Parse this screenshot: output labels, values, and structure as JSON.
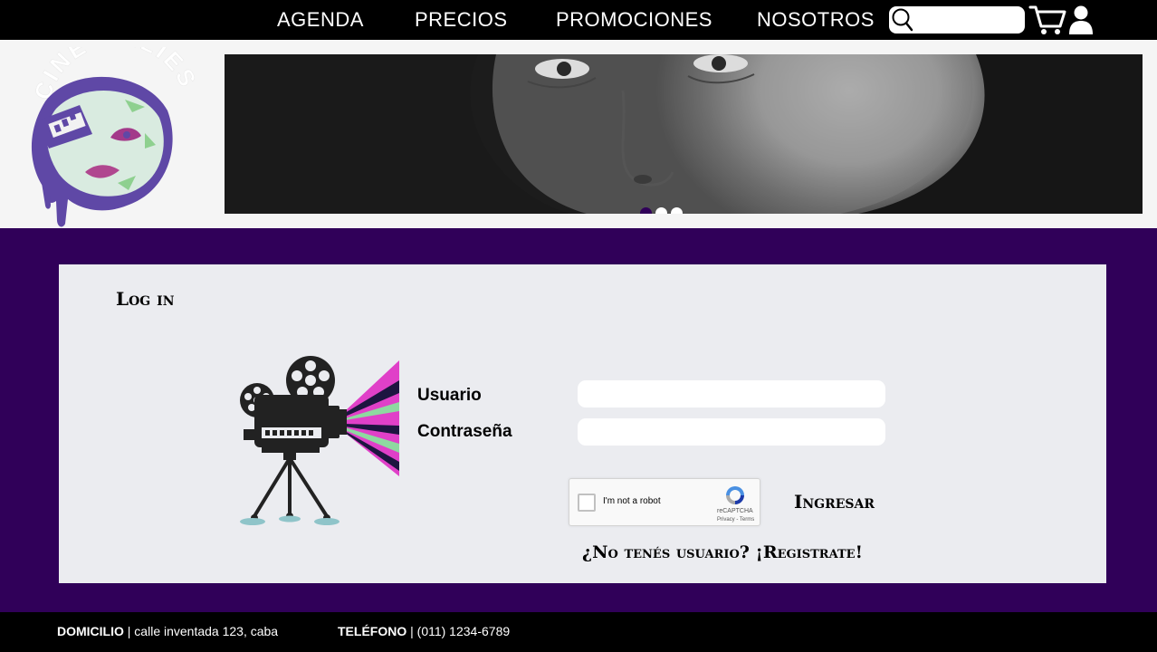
{
  "nav": {
    "items": [
      {
        "label": "AGENDA"
      },
      {
        "label": "PRECIOS"
      },
      {
        "label": "PROMOCIONES"
      },
      {
        "label": "NOSOTROS"
      }
    ],
    "search_placeholder": ""
  },
  "logo": {
    "text": "CINE MELIES"
  },
  "carousel": {
    "slides": 3,
    "active_slide": 1,
    "active_color": "#300059",
    "inactive_color": "#ffffff"
  },
  "login": {
    "title": "Log in",
    "username_label": "Usuario",
    "password_label": "Contraseña",
    "username_value": "",
    "password_value": "",
    "captcha": {
      "label": "I'm not a robot",
      "brand": "reCAPTCHA",
      "links": "Privacy - Terms"
    },
    "submit_label": "Ingresar",
    "register_label": "¿No tenés usuario? ¡Registrate!"
  },
  "footer": {
    "address_key": "DOMICILIO",
    "address_value": "| calle inventada 123, caba",
    "phone_key": "TELÉFONO",
    "phone_value": "| (011) 1234-6789"
  },
  "colors": {
    "brand_purple": "#300059",
    "nav_bg": "#000000",
    "panel_bg": "#ebecf0",
    "accent_pink": "#e040c8",
    "accent_green": "#8ed9a0"
  }
}
